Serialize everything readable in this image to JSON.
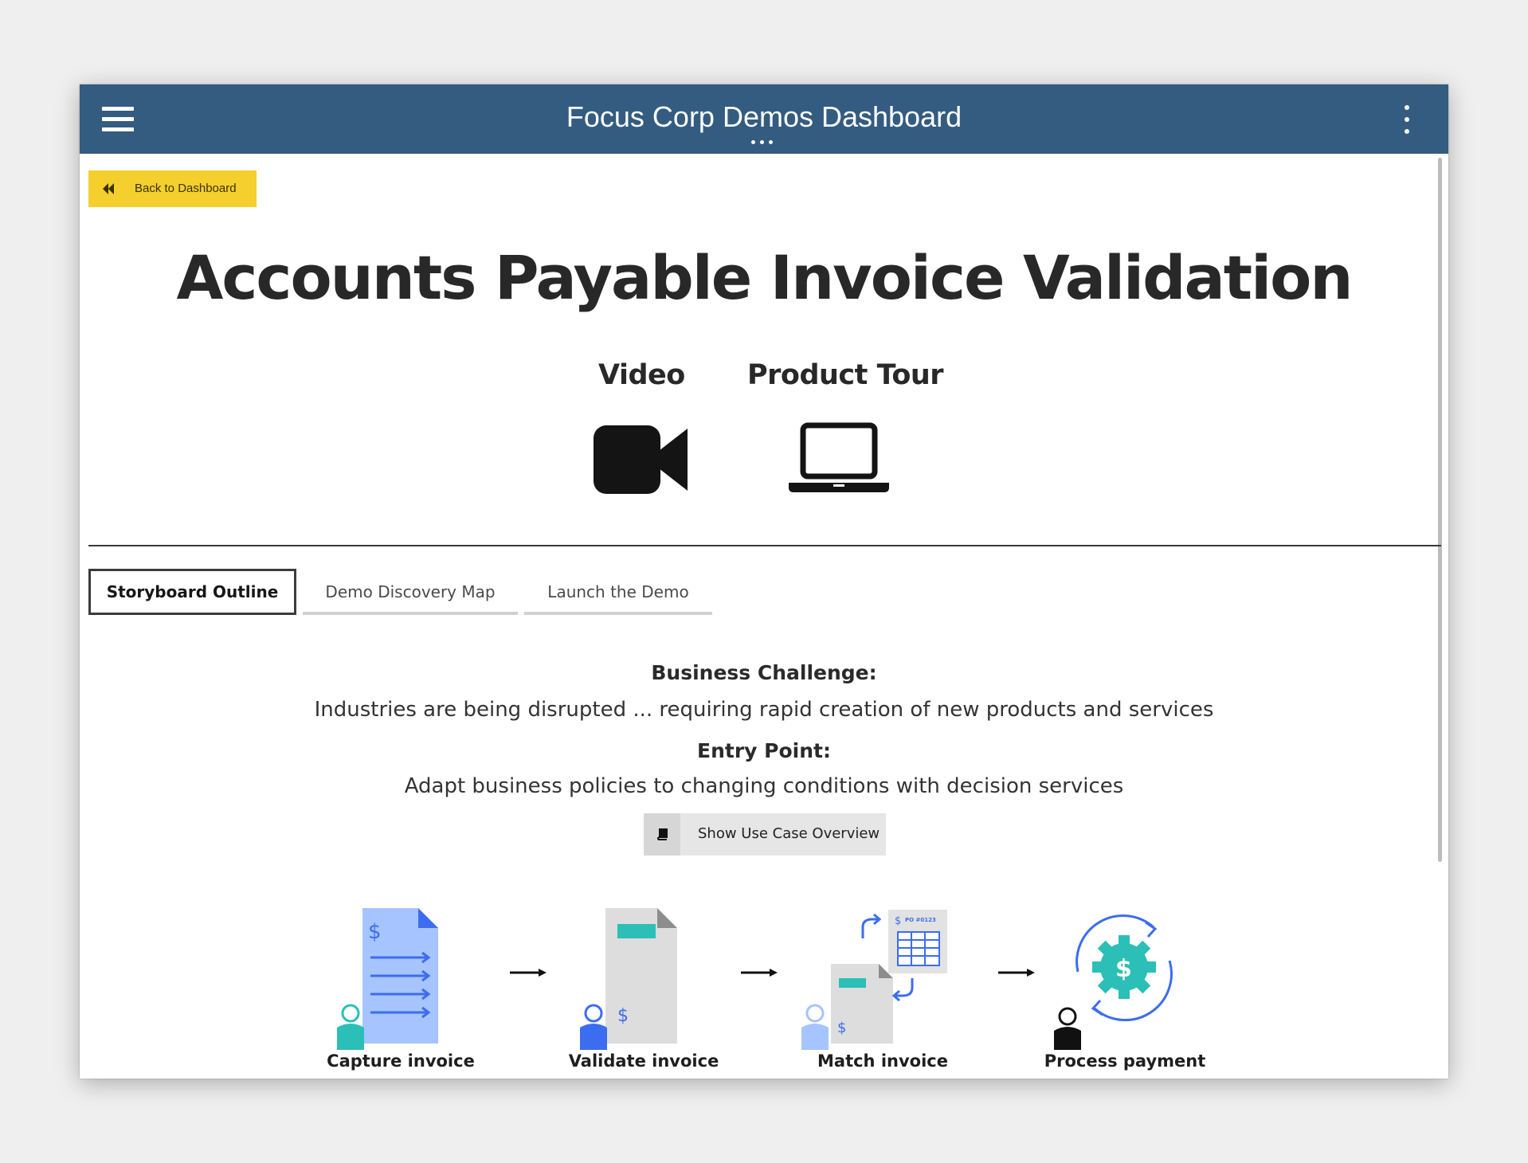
{
  "header": {
    "title": "Focus Corp Demos Dashboard"
  },
  "back_button": {
    "label": "Back to Dashboard"
  },
  "page": {
    "title": "Accounts Payable Invoice Validation"
  },
  "media": [
    {
      "label": "Video",
      "icon": "video-camera-icon"
    },
    {
      "label": "Product Tour",
      "icon": "laptop-icon"
    }
  ],
  "tabs": [
    {
      "label": "Storyboard Outline",
      "active": true
    },
    {
      "label": "Demo Discovery Map",
      "active": false
    },
    {
      "label": "Launch the Demo",
      "active": false
    }
  ],
  "storyboard": {
    "challenge_heading": "Business Challenge:",
    "challenge_text": "Industries are being disrupted ... requiring rapid creation of new products and services",
    "entry_heading": "Entry Point:",
    "entry_text": "Adapt business policies to changing conditions with decision services",
    "overview_button": "Show Use Case Overview",
    "steps": [
      {
        "label": "Capture invoice"
      },
      {
        "label": "Validate invoice"
      },
      {
        "label": "Match invoice",
        "po_text": "PO #0123"
      },
      {
        "label": "Process payment"
      }
    ]
  },
  "colors": {
    "header": "#335c80",
    "back_button": "#f4cf2d",
    "teal": "#2bbfb7",
    "blue": "#3c6df0",
    "light_blue": "#a6c4ff"
  }
}
